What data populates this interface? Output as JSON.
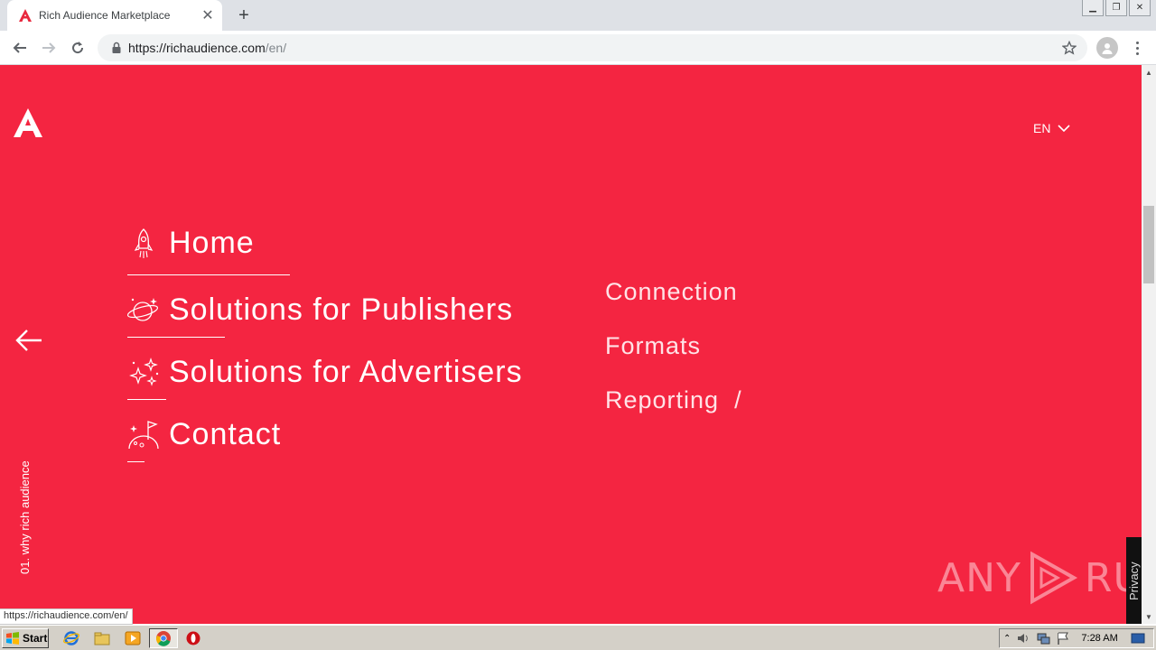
{
  "browser": {
    "tab_title": "Rich Audience Marketplace",
    "url_host": "https://richaudience.com",
    "url_path": "/en/",
    "status_url": "https://richaudience.com/en/"
  },
  "header": {
    "language": "EN"
  },
  "menu": {
    "items": [
      {
        "label": "Home",
        "icon": "rocket-icon"
      },
      {
        "label": "Solutions for Publishers",
        "icon": "planet-icon"
      },
      {
        "label": "Solutions for Advertisers",
        "icon": "sparkles-icon"
      },
      {
        "label": "Contact",
        "icon": "flag-planet-icon"
      }
    ],
    "sub_items": [
      {
        "label": "Connection"
      },
      {
        "label": "Formats"
      },
      {
        "label": "Reporting  /"
      }
    ]
  },
  "side": {
    "vertical_label": "01. why rich audience"
  },
  "privacy": {
    "label": "Privacy"
  },
  "watermark": {
    "text_left": "ANY",
    "text_right": "RUN"
  },
  "taskbar": {
    "start_label": "Start",
    "clock": "7:28 AM"
  },
  "colors": {
    "page_bg": "#f42541",
    "brand_red": "#e8283e"
  }
}
